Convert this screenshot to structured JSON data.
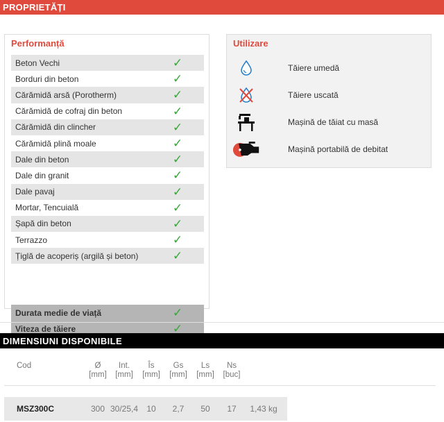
{
  "properties_header": "PROPRIETĂȚI",
  "performance": {
    "title": "Performanță",
    "rows": [
      {
        "label": "Beton Vechi",
        "check": "✓"
      },
      {
        "label": "Borduri din beton",
        "check": "✓"
      },
      {
        "label": "Cărămidă arsă (Porotherm)",
        "check": "✓"
      },
      {
        "label": "Cărămidă de cofraj din beton",
        "check": "✓"
      },
      {
        "label": "Cărămidă din clincher",
        "check": "✓"
      },
      {
        "label": "Cărămidă plină moale",
        "check": "✓"
      },
      {
        "label": "Dale din beton",
        "check": "✓"
      },
      {
        "label": "Dale din granit",
        "check": "✓"
      },
      {
        "label": "Dale pavaj",
        "check": "✓"
      },
      {
        "label": "Mortar, Tencuială",
        "check": "✓"
      },
      {
        "label": "Șapă din beton",
        "check": "✓"
      },
      {
        "label": "Terrazzo",
        "check": "✓"
      },
      {
        "label": "Țiglă de acoperiș (argilă și beton)",
        "check": "✓"
      }
    ],
    "summary": [
      {
        "label": "Durata medie de viață",
        "check": "✓"
      },
      {
        "label": "Viteza de tăiere",
        "check": "✓"
      }
    ]
  },
  "usage": {
    "title": "Utilizare",
    "items": [
      {
        "icon": "water-drop-icon",
        "label": "Tăiere umedă"
      },
      {
        "icon": "no-water-icon",
        "label": "Tăiere uscată"
      },
      {
        "icon": "table-saw-icon",
        "label": "Mașină de tăiat cu masă"
      },
      {
        "icon": "cut-off-saw-icon",
        "label": "Mașină portabilă de debitat"
      }
    ]
  },
  "dimensions": {
    "header": "DIMENSIUNI DISPONIBILE",
    "columns": [
      {
        "name": "Cod",
        "unit": ""
      },
      {
        "name": "Ø",
        "unit": "[mm]"
      },
      {
        "name": "Int.",
        "unit": "[mm]"
      },
      {
        "name": "Îs",
        "unit": "[mm]"
      },
      {
        "name": "Gs",
        "unit": "[mm]"
      },
      {
        "name": "Ls",
        "unit": "[mm]"
      },
      {
        "name": "Ns",
        "unit": "[buc]"
      }
    ],
    "row": {
      "code": "MSZ300C",
      "diameter": "300",
      "inner": "30/25,4",
      "height": "10",
      "thickness": "2,7",
      "length": "50",
      "segments": "17",
      "weight": "1,43 kg"
    }
  },
  "colors": {
    "accent_red": "#e04a3c",
    "check_green": "#3aa43a"
  }
}
